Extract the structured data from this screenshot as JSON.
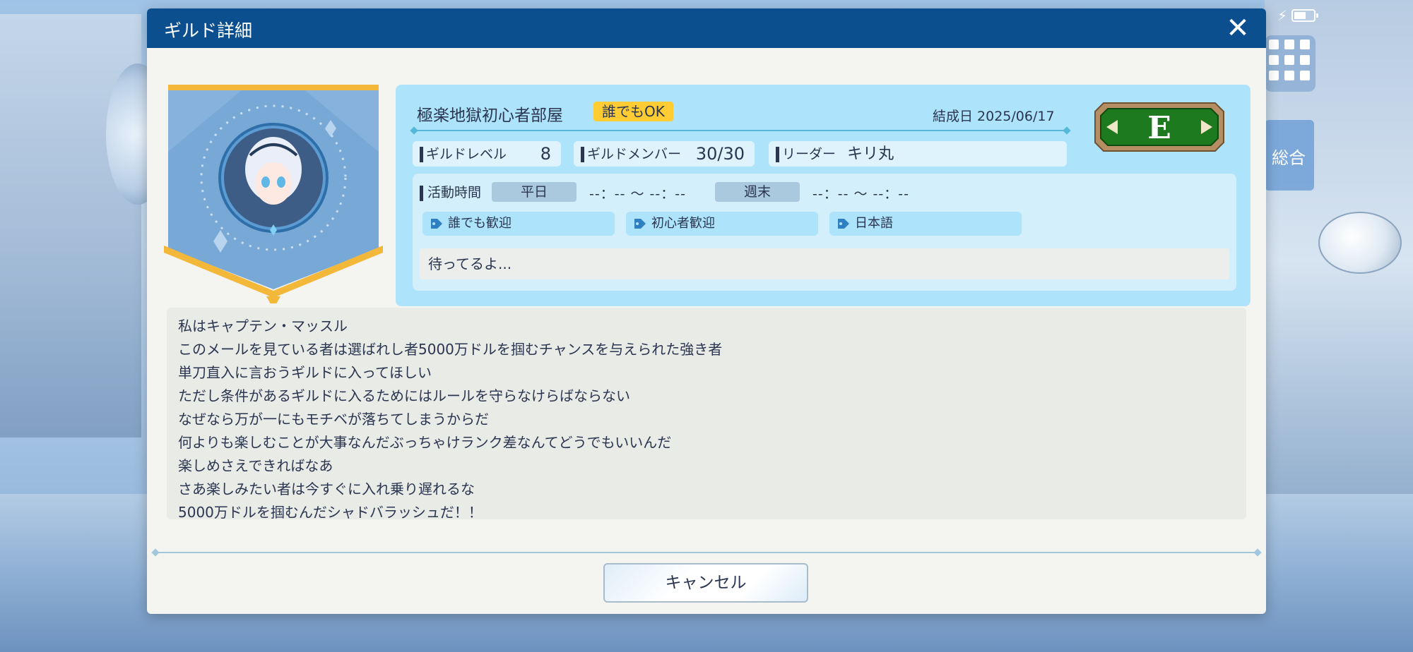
{
  "dialog": {
    "title": "ギルド詳細",
    "close_icon": "close-icon"
  },
  "guild": {
    "name": "極楽地獄初心者部屋",
    "open_badge": "誰でもOK",
    "founded": "結成日 2025/06/17",
    "rank": "E",
    "level_label": "ギルドレベル",
    "level_value": "8",
    "members_label": "ギルドメンバー",
    "members_value": "30/30",
    "leader_label": "リーダー",
    "leader_value": "キリ丸"
  },
  "activity": {
    "label": "活動時間",
    "weekday_label": "平日",
    "weekday_time": "--：-- 〜 --：--",
    "weekend_label": "週末",
    "weekend_time": "--：-- 〜 --：--",
    "tags": [
      "誰でも歓迎",
      "初心者歓迎",
      "日本語"
    ],
    "message": "待ってるよ..."
  },
  "description": [
    "私はキャプテン・マッスル",
    "このメールを見ている者は選ばれし者5000万ドルを掴むチャンスを与えられた強き者",
    "単刀直入に言おうギルドに入ってほしい",
    "ただし条件があるギルドに入るためにはルールを守らなけらばならない",
    "なぜなら万が一にもモチベが落ちてしまうからだ",
    "何よりも楽しむことが大事なんだぶっちゃけランク差なんてどうでもいいんだ",
    "楽しめさえできればなあ",
    "さあ楽しみたい者は今すぐに入れ乗り遅れるな",
    "5000万ドルを掴むんだシャドバラッシュだ！！"
  ],
  "footer": {
    "cancel_label": "キャンセル"
  },
  "background": {
    "side_label": "総合"
  },
  "status_bar": {
    "battery_percent": 60
  },
  "colors": {
    "header": "#0c4f8e",
    "badge_yellow": "#ffcc33",
    "panel_blue": "#ade4fb",
    "rank_green": "#1e7a1e"
  }
}
